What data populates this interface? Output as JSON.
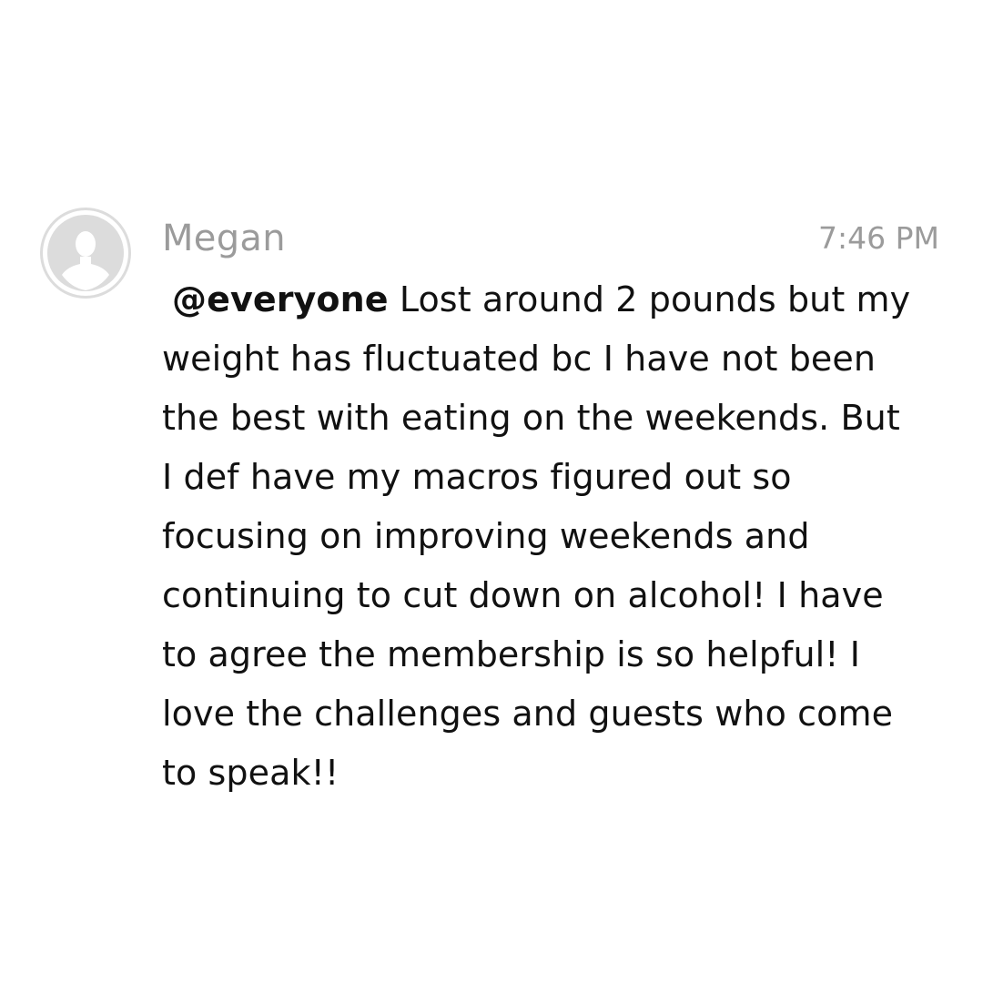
{
  "message": {
    "author": "Megan",
    "timestamp": "7:46 PM",
    "mention": "@everyone",
    "lines": [
      " Lost around 2 pounds but my",
      "weight has fluctuated bc I have not been",
      "the best with eating on the weekends. But",
      "I def have my macros figured out so",
      "focusing on improving weekends and",
      "continuing to cut down on alcohol! I have",
      "to agree the membership is so helpful! I",
      "love the challenges and guests who come",
      "to speak!!"
    ],
    "avatar_icon": "default-user-avatar-icon"
  },
  "colors": {
    "background": "#ffffff",
    "meta_text": "#9b9b9b",
    "body_text": "#111111",
    "avatar_bg": "#dcdcdc",
    "avatar_fg": "#ffffff"
  }
}
